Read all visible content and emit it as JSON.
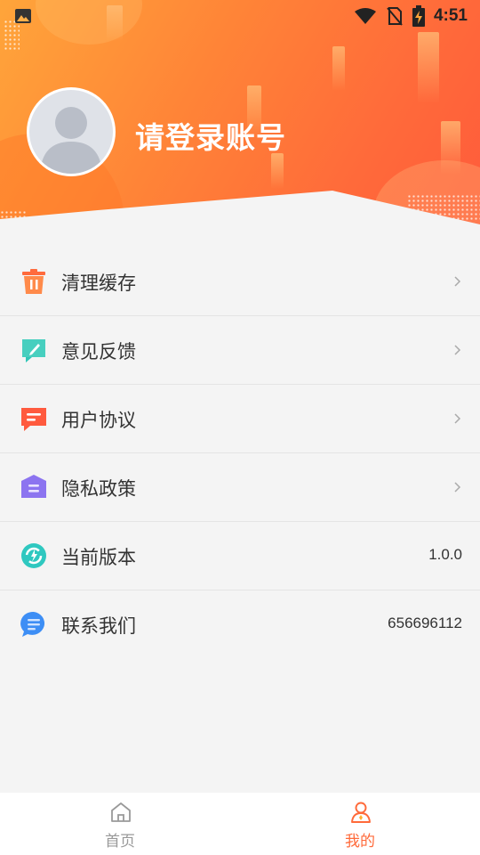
{
  "status_bar": {
    "time": "4:51",
    "icons": [
      "image-notification-icon",
      "wifi-icon",
      "no-sim-icon",
      "battery-charging-icon"
    ]
  },
  "profile": {
    "login_prompt": "请登录账号",
    "avatar_icon": "default-avatar-icon"
  },
  "colors": {
    "accent": "#ff6a3a",
    "header_gradient_start": "#ffa53a",
    "header_gradient_end": "#ff5b3b"
  },
  "menu": {
    "items": [
      {
        "label": "清理缓存",
        "icon": "trash-icon",
        "trailing": "chevron",
        "icon_color": "#ff6b3d"
      },
      {
        "label": "意见反馈",
        "icon": "feedback-edit-icon",
        "trailing": "chevron",
        "icon_color": "#2fc6b7"
      },
      {
        "label": "用户协议",
        "icon": "agreement-message-icon",
        "trailing": "chevron",
        "icon_color": "#ff5a3e"
      },
      {
        "label": "隐私政策",
        "icon": "privacy-shield-icon",
        "trailing": "chevron",
        "icon_color": "#8c74f0"
      },
      {
        "label": "当前版本",
        "icon": "version-refresh-icon",
        "trailing": "value",
        "value": "1.0.0",
        "icon_color": "#2fc8c0"
      },
      {
        "label": "联系我们",
        "icon": "contact-chat-icon",
        "trailing": "value",
        "value": "656696112",
        "icon_color": "#3d8ef5"
      }
    ]
  },
  "bottom_nav": {
    "tabs": [
      {
        "label": "首页",
        "icon": "home-icon",
        "active": false
      },
      {
        "label": "我的",
        "icon": "profile-icon",
        "active": true
      }
    ]
  }
}
